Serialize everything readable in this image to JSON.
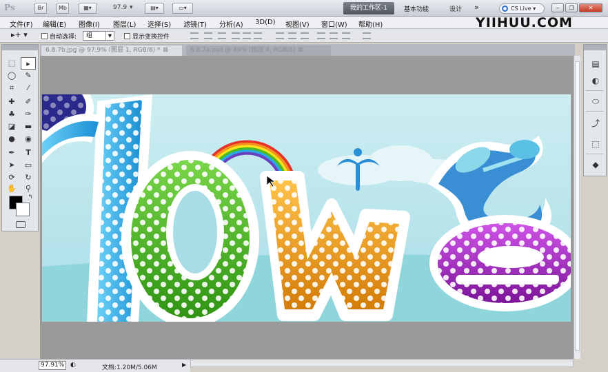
{
  "app": {
    "logo": "Ps",
    "zoom": "97.9",
    "workspace_active": "我的工作区-1",
    "workspace_basic": "基本功能",
    "workspace_design": "设计",
    "overflow": "»",
    "cslive": "CS Live"
  },
  "brand": "YIIHUU.COM",
  "menu": [
    "文件(F)",
    "编辑(E)",
    "图像(I)",
    "图层(L)",
    "选择(S)",
    "滤镜(T)",
    "分析(A)",
    "3D(D)",
    "视图(V)",
    "窗口(W)",
    "帮助(H)"
  ],
  "options": {
    "auto_select_label": "自动选择:",
    "auto_select_value": "组",
    "show_transform": "显示变换控件"
  },
  "tabs": [
    {
      "label": "6.8.7b.jpg @ 97.9% (图层 1, RGB/8) *",
      "close": "⊠"
    },
    {
      "label": "6.8.7a.psd @ 49% (图层 4, RGB/8)",
      "close": "⊠"
    }
  ],
  "status": {
    "zoom": "97.91%",
    "doc_info": "文档:1.20M/5.06M"
  },
  "artwork_text": "lowe",
  "colors": {
    "sky": "#bfe6ec",
    "blue_letter": "#29a9e6",
    "green_letter": "#4cbb1f",
    "orange_letter": "#f0a11c",
    "purple_letter": "#a22ec3"
  }
}
